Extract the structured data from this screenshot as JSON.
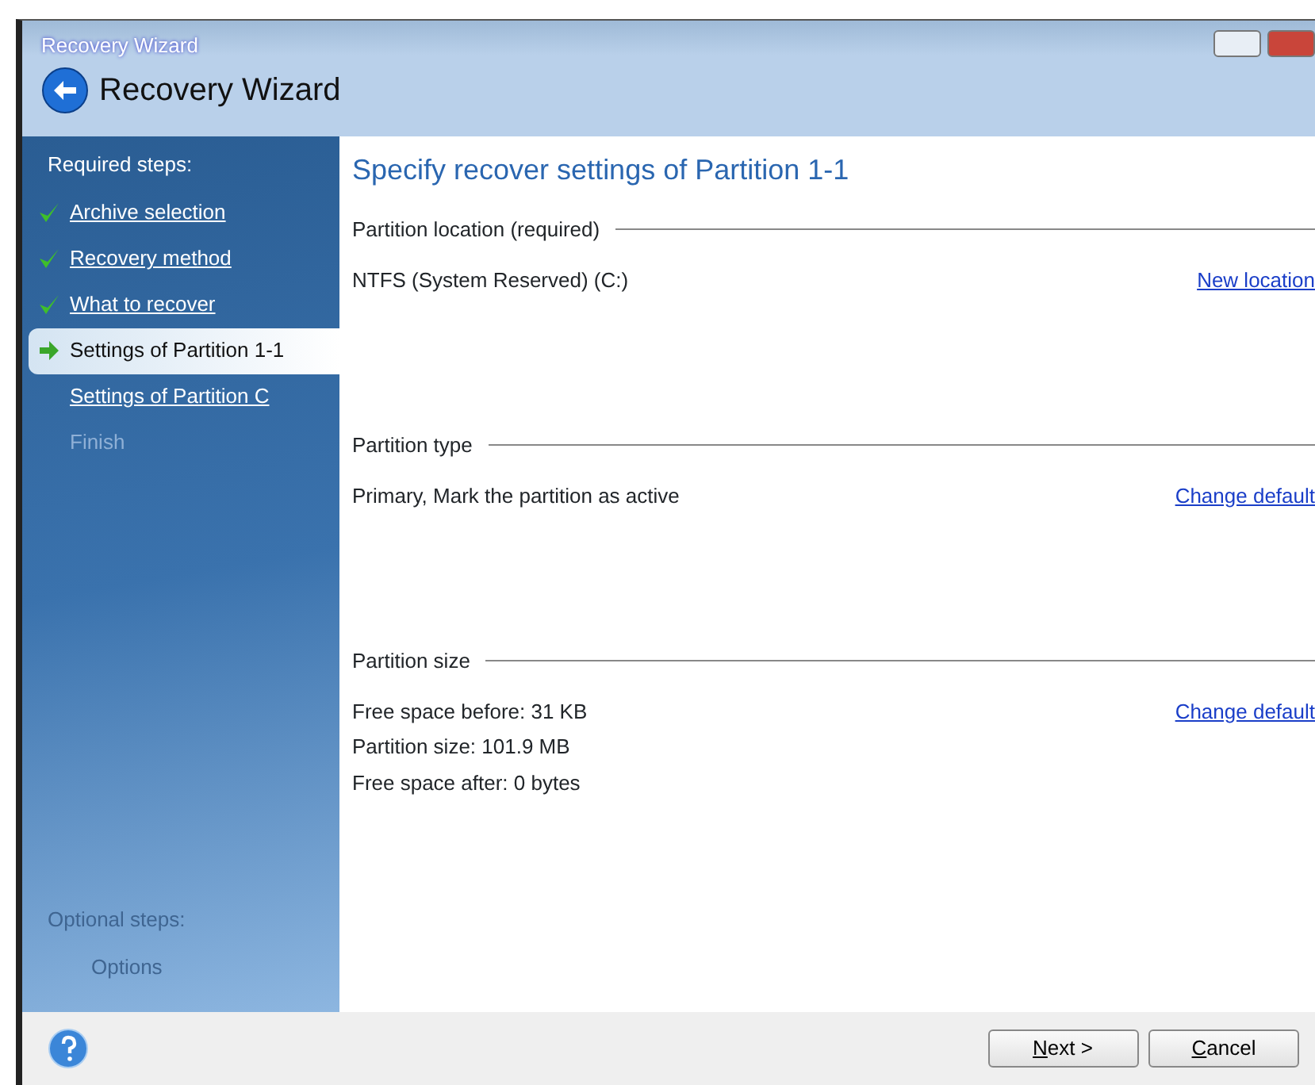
{
  "window": {
    "title": "Recovery Wizard",
    "header": "Recovery Wizard"
  },
  "sidebar": {
    "required_heading": "Required steps:",
    "steps": [
      {
        "label": "Archive selection",
        "done": true,
        "selected": false,
        "disabled": false
      },
      {
        "label": "Recovery method",
        "done": true,
        "selected": false,
        "disabled": false
      },
      {
        "label": "What to recover",
        "done": true,
        "selected": false,
        "disabled": false
      },
      {
        "label": "Settings of Partition 1-1",
        "done": false,
        "selected": true,
        "disabled": false
      },
      {
        "label": "Settings of Partition C",
        "done": false,
        "selected": false,
        "disabled": false
      },
      {
        "label": "Finish",
        "done": false,
        "selected": false,
        "disabled": true
      }
    ],
    "optional_heading": "Optional steps:",
    "optional_steps": [
      {
        "label": "Options",
        "done": false,
        "selected": false,
        "disabled": true
      }
    ]
  },
  "page_title": "Specify recover settings of Partition 1-1",
  "sections": [
    {
      "title": "Partition location (required)",
      "lines": [
        "NTFS (System Reserved) (C:)"
      ],
      "link": "New location"
    },
    {
      "title": "Partition type",
      "lines": [
        "Primary, Mark the partition as active"
      ],
      "link": "Change default"
    },
    {
      "title": "Partition size",
      "lines": [
        "Free space before: 31 KB",
        "Partition size: 101.9 MB",
        "Free space after: 0 bytes"
      ],
      "link": "Change default"
    }
  ],
  "buttons": [
    {
      "mnemonic": "N",
      "rest": "ext >"
    },
    {
      "mnemonic": "C",
      "rest": "ancel"
    }
  ]
}
